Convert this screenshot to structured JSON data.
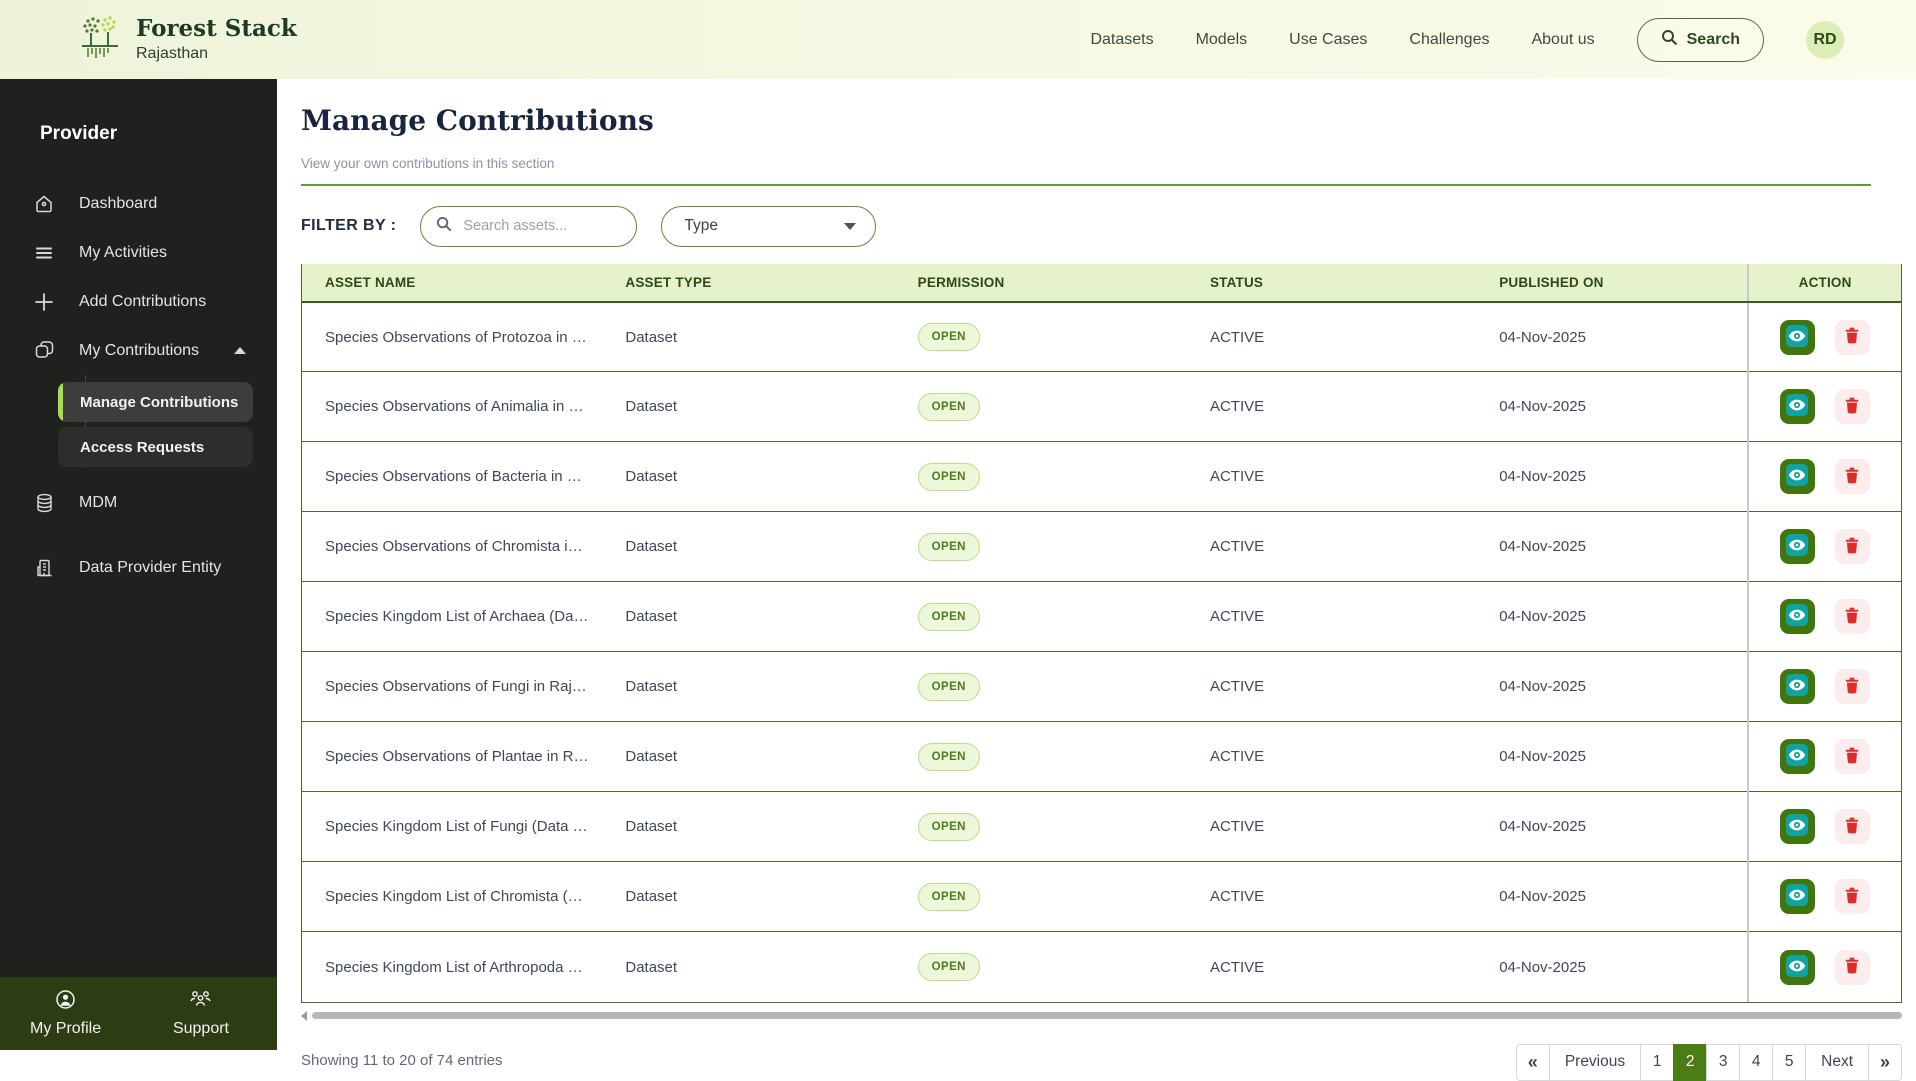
{
  "brand": {
    "name": "Forest Stack",
    "region": "Rajasthan"
  },
  "nav": {
    "items": [
      "Datasets",
      "Models",
      "Use Cases",
      "Challenges",
      "About us"
    ],
    "search_label": "Search",
    "avatar_initials": "RD"
  },
  "sidebar": {
    "role_label": "Provider",
    "items": [
      {
        "label": "Dashboard",
        "icon": "home-icon"
      },
      {
        "label": "My Activities",
        "icon": "menu-icon"
      },
      {
        "label": "Add Contributions",
        "icon": "plus-icon"
      },
      {
        "label": "My Contributions",
        "icon": "box-icon",
        "expanded": true,
        "children": [
          {
            "label": "Manage Contributions",
            "active": true
          },
          {
            "label": "Access Requests",
            "active": false
          }
        ]
      },
      {
        "label": "MDM",
        "icon": "database-icon"
      },
      {
        "label": "Data Provider Entity",
        "icon": "building-icon"
      }
    ],
    "footer": [
      {
        "label": "My Profile",
        "icon": "user-icon"
      },
      {
        "label": "Support",
        "icon": "people-icon"
      }
    ]
  },
  "page": {
    "title": "Manage Contributions",
    "subtitle": "View your own contributions in this section",
    "filter_label": "FILTER BY :",
    "search_placeholder": "Search assets...",
    "type_label": "Type"
  },
  "table": {
    "columns": [
      "ASSET NAME",
      "ASSET TYPE",
      "PERMISSION",
      "STATUS",
      "PUBLISHED ON",
      "ACTION"
    ],
    "rows": [
      {
        "name": "Species Observations of Protozoa in …",
        "type": "Dataset",
        "permission": "OPEN",
        "status": "ACTIVE",
        "published": "04-Nov-2025"
      },
      {
        "name": "Species Observations of Animalia in …",
        "type": "Dataset",
        "permission": "OPEN",
        "status": "ACTIVE",
        "published": "04-Nov-2025"
      },
      {
        "name": "Species Observations of Bacteria in …",
        "type": "Dataset",
        "permission": "OPEN",
        "status": "ACTIVE",
        "published": "04-Nov-2025"
      },
      {
        "name": "Species Observations of Chromista i…",
        "type": "Dataset",
        "permission": "OPEN",
        "status": "ACTIVE",
        "published": "04-Nov-2025"
      },
      {
        "name": "Species Kingdom List of Archaea (Da…",
        "type": "Dataset",
        "permission": "OPEN",
        "status": "ACTIVE",
        "published": "04-Nov-2025"
      },
      {
        "name": "Species Observations of Fungi in Raj…",
        "type": "Dataset",
        "permission": "OPEN",
        "status": "ACTIVE",
        "published": "04-Nov-2025"
      },
      {
        "name": "Species Observations of Plantae in R…",
        "type": "Dataset",
        "permission": "OPEN",
        "status": "ACTIVE",
        "published": "04-Nov-2025"
      },
      {
        "name": "Species Kingdom List of Fungi (Data …",
        "type": "Dataset",
        "permission": "OPEN",
        "status": "ACTIVE",
        "published": "04-Nov-2025"
      },
      {
        "name": "Species Kingdom List of Chromista (…",
        "type": "Dataset",
        "permission": "OPEN",
        "status": "ACTIVE",
        "published": "04-Nov-2025"
      },
      {
        "name": "Species Kingdom List of Arthropoda …",
        "type": "Dataset",
        "permission": "OPEN",
        "status": "ACTIVE",
        "published": "04-Nov-2025"
      }
    ],
    "action_icons": [
      "eye-icon",
      "trash-icon"
    ]
  },
  "footer": {
    "showing_text": "Showing 11 to 20 of 74 entries",
    "pagination": {
      "first": "«",
      "prev": "Previous",
      "pages": [
        "1",
        "2",
        "3",
        "4",
        "5"
      ],
      "active_page": "2",
      "next": "Next",
      "last": "»"
    }
  },
  "colors": {
    "accent_green": "#4c7c15",
    "sidebar_accent": "#a5e04b",
    "table_header_bg": "#e5f2cc",
    "badge_text": "#4b7d20",
    "delete_red": "#dd2c2c",
    "view_teal": "#0fa3a3"
  }
}
